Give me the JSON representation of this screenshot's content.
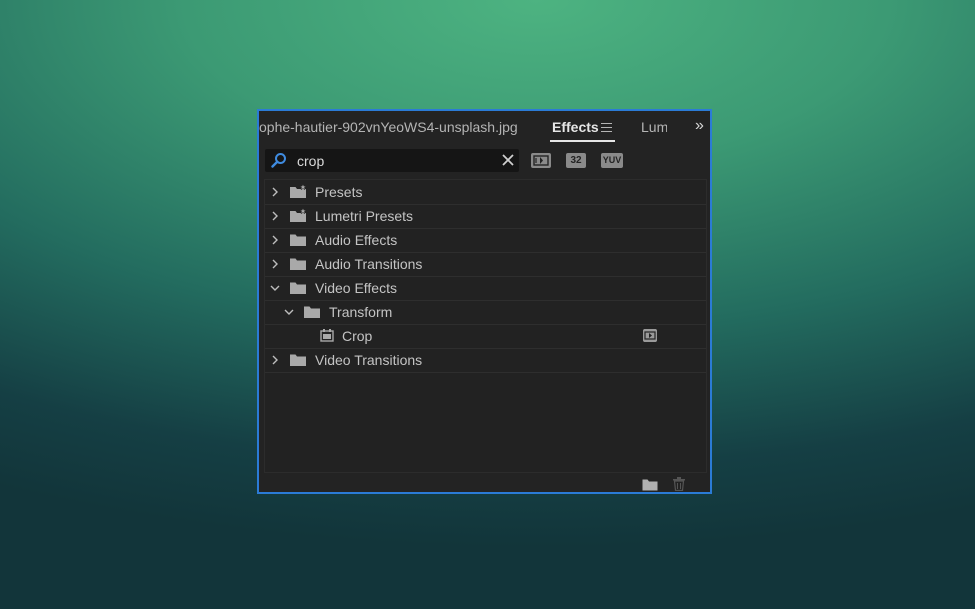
{
  "panel": {
    "tabs": {
      "source_label": "ophe-hautier-902vnYeoWS4-unsplash.jpg",
      "effects_label": "Effects",
      "lumetri_label": "Lum"
    },
    "overflow_label": "»"
  },
  "search": {
    "value": "crop"
  },
  "filters": {
    "accelerated_icon": "accelerated-effects-icon",
    "bit32_label": "32",
    "yuv_label": "YUV"
  },
  "tree": {
    "presets": {
      "label": "Presets",
      "expanded": false
    },
    "lumetri_presets": {
      "label": "Lumetri Presets",
      "expanded": false
    },
    "audio_effects": {
      "label": "Audio Effects",
      "expanded": false
    },
    "audio_transitions": {
      "label": "Audio Transitions",
      "expanded": false
    },
    "video_effects": {
      "label": "Video Effects",
      "expanded": true
    },
    "transform": {
      "label": "Transform",
      "expanded": true
    },
    "crop": {
      "label": "Crop",
      "accelerated": true
    },
    "video_transitions": {
      "label": "Video Transitions",
      "expanded": false
    }
  },
  "footer": {
    "new_bin_icon": "new-bin-icon",
    "delete_icon": "trash-icon"
  },
  "colors": {
    "panel_bg": "#232323",
    "focus_border": "#2b7bd6",
    "search_icon": "#3f8be0",
    "text": "#c4c4c4"
  }
}
